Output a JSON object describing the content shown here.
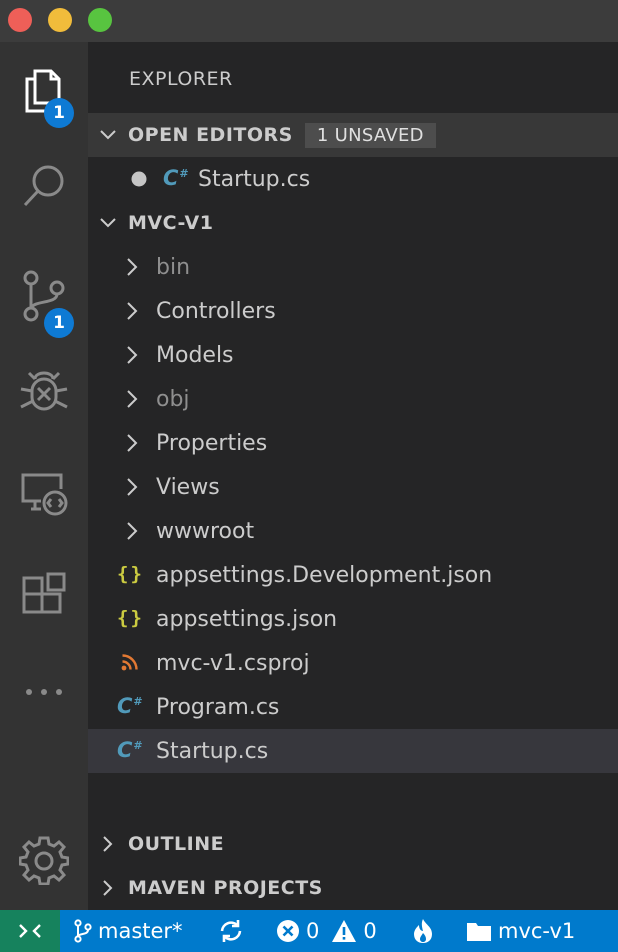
{
  "window": {
    "controls": [
      "close",
      "minimize",
      "zoom"
    ]
  },
  "activity_bar": {
    "items": [
      {
        "icon": "files-icon",
        "badge": "1"
      },
      {
        "icon": "search-icon"
      },
      {
        "icon": "source-control-icon",
        "badge": "1"
      },
      {
        "icon": "debug-icon"
      },
      {
        "icon": "remote-explorer-icon"
      },
      {
        "icon": "extensions-icon"
      },
      {
        "icon": "more-icon"
      }
    ],
    "settings_icon": "gear-icon"
  },
  "sidebar": {
    "title": "EXPLORER",
    "open_editors": {
      "header": "OPEN EDITORS",
      "badge": "1 UNSAVED",
      "files": [
        {
          "name": "Startup.cs",
          "icon": "csharp-icon",
          "dirty": true
        }
      ]
    },
    "project": {
      "header": "MVC-V1",
      "items": [
        {
          "name": "bin",
          "type": "folder",
          "dimmed": true
        },
        {
          "name": "Controllers",
          "type": "folder"
        },
        {
          "name": "Models",
          "type": "folder"
        },
        {
          "name": "obj",
          "type": "folder",
          "dimmed": true
        },
        {
          "name": "Properties",
          "type": "folder"
        },
        {
          "name": "Views",
          "type": "folder"
        },
        {
          "name": "wwwroot",
          "type": "folder"
        },
        {
          "name": "appsettings.Development.json",
          "type": "json"
        },
        {
          "name": "appsettings.json",
          "type": "json"
        },
        {
          "name": "mvc-v1.csproj",
          "type": "rss"
        },
        {
          "name": "Program.cs",
          "type": "csharp"
        },
        {
          "name": "Startup.cs",
          "type": "csharp",
          "selected": true
        }
      ]
    },
    "outline_header": "OUTLINE",
    "maven_header": "MAVEN PROJECTS"
  },
  "status_bar": {
    "branch": "master*",
    "errors": "0",
    "warnings": "0",
    "folder": "mvc-v1"
  },
  "colors": {
    "accent": "#007acc",
    "remote": "#16825d",
    "badge": "#0e7ad4",
    "json": "#cbcb41",
    "csharp": "#519aba",
    "rss": "#e37933"
  }
}
